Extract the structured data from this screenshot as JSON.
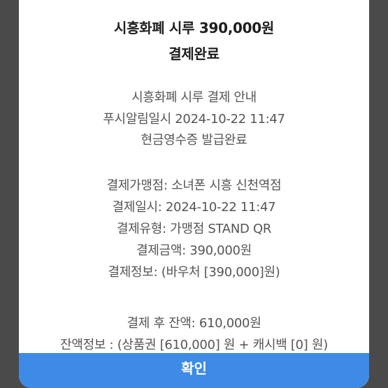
{
  "dialog": {
    "title_line1": "시흥화폐 시루 390,000원",
    "title_line2": "결제완료",
    "notice": [
      "시흥화폐 시루 결제 안내",
      "푸시알림일시 2024-10-22 11:47",
      "현금영수증 발급완료"
    ],
    "details": [
      "결제가맹점: 소녀폰 시흥 신천역점",
      "결제일시: 2024-10-22 11:47",
      "결제유형: 가맹점 STAND QR",
      "결제금액: 390,000원",
      "결제정보: (바우처 [390,000]원)"
    ],
    "balance": [
      "결제 후 잔액: 610,000원",
      "잔액정보 : (상품권 [610,000] 원 + 캐시백 [0] 원)"
    ],
    "confirm_label": "확인"
  },
  "colors": {
    "overlay": "#4a4a4a",
    "dialog_bg": "#ffffff",
    "title_text": "#1e1e1e",
    "body_text": "#555555",
    "button_bg": "#3d8be6",
    "button_text": "#ffffff"
  }
}
